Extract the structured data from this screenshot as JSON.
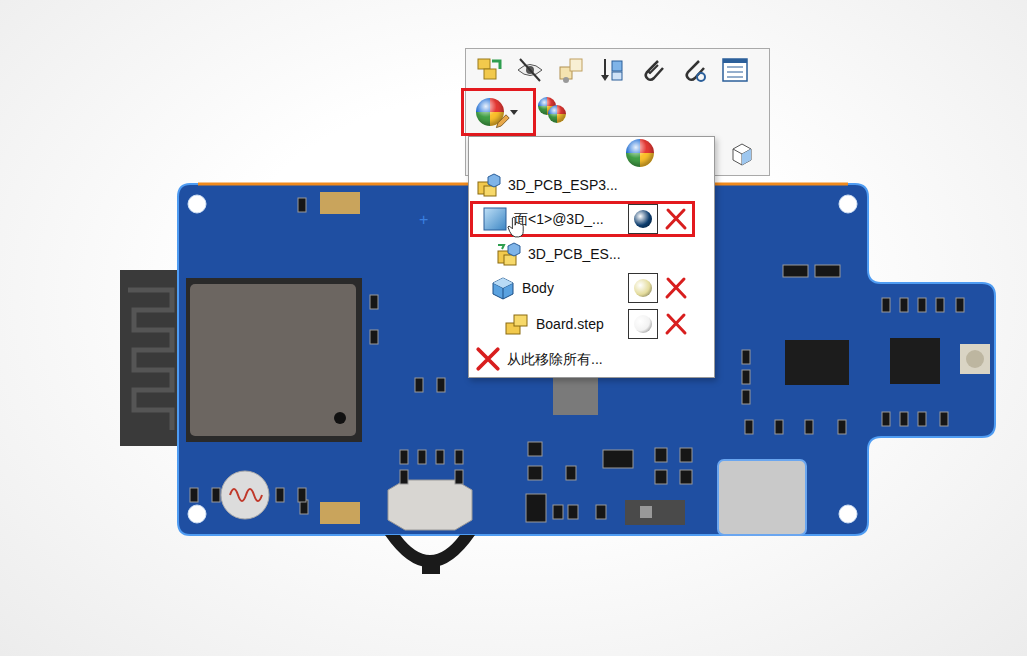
{
  "viewport": {
    "origin_marker": "+"
  },
  "toolbar": {
    "appearance_button": {
      "highlighted": true
    }
  },
  "appearance_menu": {
    "items": [
      {
        "label": "3D_PCB_ESP3...",
        "kind": "assembly",
        "level": 0,
        "color": null,
        "removable": false,
        "highlighted": false,
        "hovered": false
      },
      {
        "label": "面<1>@3D_...",
        "kind": "face",
        "level": 0,
        "color": "#0d3d6e",
        "removable": true,
        "highlighted": true,
        "hovered": true
      },
      {
        "label": "3D_PCB_ES...",
        "kind": "subassembly",
        "level": 1,
        "color": null,
        "removable": false,
        "highlighted": false,
        "hovered": false
      },
      {
        "label": "Body",
        "kind": "body",
        "level": 1,
        "color": "#e4dc9c",
        "removable": true,
        "highlighted": false,
        "hovered": false
      },
      {
        "label": "Board.step",
        "kind": "part",
        "level": 2,
        "color": "#f2f2f2",
        "removable": true,
        "highlighted": false,
        "hovered": false
      }
    ],
    "remove_all": {
      "label": "从此移除所有..."
    }
  }
}
